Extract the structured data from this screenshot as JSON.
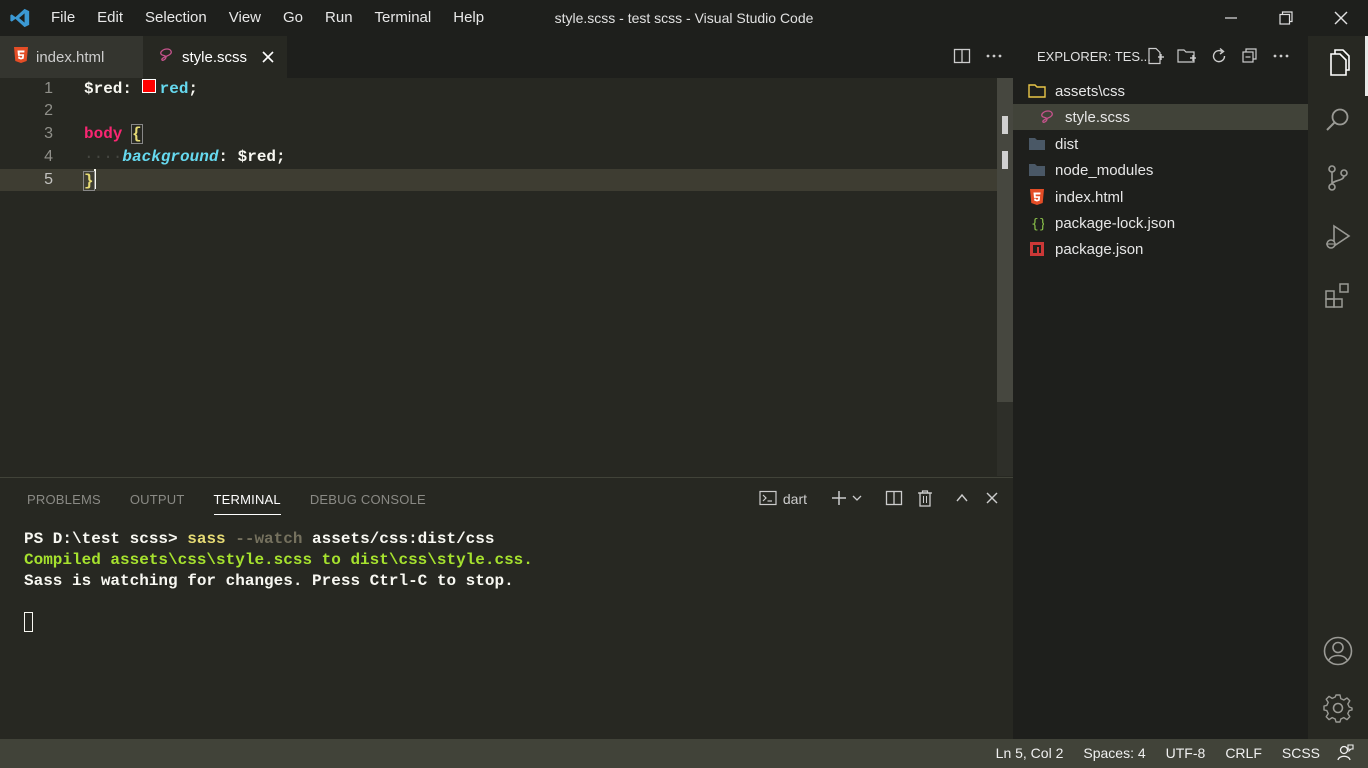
{
  "window": {
    "title": "style.scss - test scss - Visual Studio Code"
  },
  "menu": [
    "File",
    "Edit",
    "Selection",
    "View",
    "Go",
    "Run",
    "Terminal",
    "Help"
  ],
  "tabs": [
    {
      "label": "index.html",
      "icon": "html5-icon",
      "active": false
    },
    {
      "label": "style.scss",
      "icon": "sass-icon",
      "active": true
    }
  ],
  "editor": {
    "line_numbers": [
      "1",
      "2",
      "3",
      "4",
      "5"
    ],
    "line1": {
      "var": "$red",
      "colon": ": ",
      "value": "red",
      "semi": ";"
    },
    "line3": {
      "selector": "body",
      "brace": "{"
    },
    "line4": {
      "indent": "····",
      "property": "background",
      "colon": ": ",
      "value": "$red;"
    },
    "line5": {
      "brace": "}"
    },
    "color_swatch": "#ff0000"
  },
  "panel": {
    "tabs": [
      "PROBLEMS",
      "OUTPUT",
      "TERMINAL",
      "DEBUG CONSOLE"
    ],
    "active_tab": "TERMINAL",
    "terminal_selector": "dart",
    "terminal": {
      "prompt": "PS D:\\test scss> ",
      "command": "sass",
      "flag": " --watch",
      "args": " assets/css:dist/css",
      "line2": "Compiled assets\\css\\style.scss to dist\\css\\style.css.",
      "line3": "Sass is watching for changes. Press Ctrl-C to stop."
    }
  },
  "explorer": {
    "header": "EXPLORER: TES...",
    "items": [
      {
        "label": "assets\\css",
        "icon": "folder-icon"
      },
      {
        "label": "style.scss",
        "icon": "sass-icon",
        "selected": true
      },
      {
        "label": "dist",
        "icon": "folder-icon"
      },
      {
        "label": "node_modules",
        "icon": "folder-icon"
      },
      {
        "label": "index.html",
        "icon": "html5-icon"
      },
      {
        "label": "package-lock.json",
        "icon": "json-icon"
      },
      {
        "label": "package.json",
        "icon": "npm-icon"
      }
    ]
  },
  "statusbar": {
    "position": "Ln 5, Col 2",
    "spaces": "Spaces: 4",
    "encoding": "UTF-8",
    "eol": "CRLF",
    "language": "SCSS"
  },
  "colors": {
    "accent_blue": "#3b99d4",
    "html_orange": "#e44d26",
    "sass_pink": "#c6538c",
    "status_bar": "#414339"
  }
}
